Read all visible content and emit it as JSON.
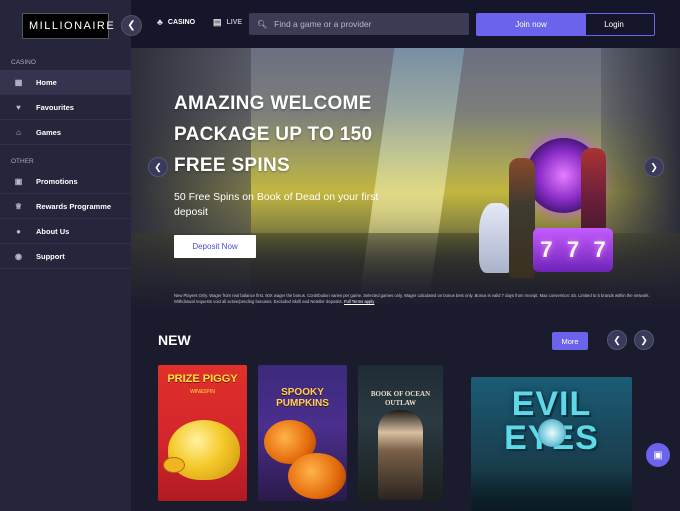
{
  "brand": {
    "logo_text": "MILLIONAIRE"
  },
  "sidebar": {
    "casino_label": "CASINO",
    "other_label": "OTHER",
    "items": [
      {
        "label": "Home",
        "icon": "grid-icon",
        "active": true
      },
      {
        "label": "Favourites",
        "icon": "heart-icon"
      },
      {
        "label": "Games",
        "icon": "bank-icon"
      },
      {
        "label": "Promotions",
        "icon": "gift-icon"
      },
      {
        "label": "Rewards Programme",
        "icon": "trophy-icon"
      },
      {
        "label": "About Us",
        "icon": "info-icon"
      },
      {
        "label": "Support",
        "icon": "chat-icon"
      }
    ]
  },
  "header": {
    "tabs": [
      {
        "label": "CASINO",
        "icon": "clubs-icon"
      },
      {
        "label": "LIVE",
        "icon": "live-icon"
      }
    ],
    "search": {
      "placeholder": "Find a game or a provider"
    },
    "join_label": "Join now",
    "login_label": "Login"
  },
  "hero": {
    "title": "AMAZING WELCOME PACKAGE UP TO 150 FREE SPINS",
    "subtitle": "50 Free Spins on Book of Dead on your first deposit",
    "cta_label": "Deposit Now",
    "terms": "New Players Only. Wager from real balance first. 50X wager the bonus. Contribution varies per game. Selected games only. Wager calculated on bonus bets only. Bonus is valid 7 days from receipt. Max conversion: £5. Limited to 5 brands within the network. Withdrawal requests void all active/pending bonuses. Excluded Skrill and Neteller deposits.",
    "terms_link": "Full Terms apply"
  },
  "new_section": {
    "title": "NEW",
    "more_label": "More",
    "games": [
      {
        "title": "PRIZE PIGGY",
        "subtitle": "WIN&SPIN"
      },
      {
        "title": "SPOOKY PUMPKINS"
      },
      {
        "title": "BOOK OF OCEAN OUTLAW"
      },
      {
        "title": "EVIL EYES"
      }
    ]
  },
  "colors": {
    "accent": "#6b63ec",
    "sidebar_bg": "#25253c",
    "page_bg": "#1b1b2e"
  }
}
